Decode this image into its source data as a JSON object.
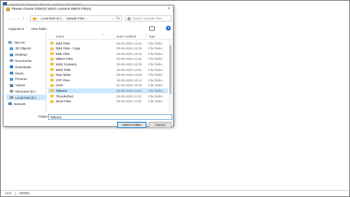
{
  "app": {
    "title": "4n6 Email Forensics Wizard - A Product by 4n6 Inc.",
    "version": "v4.5",
    "mode": "DEMO"
  },
  "dialog": {
    "title": "Please choose folder(s) which contains MBOX File(s).",
    "close_glyph": "×",
    "nav": {
      "back": "←",
      "forward": "→",
      "recent": "⌄",
      "up": "↑"
    },
    "address": {
      "segments": [
        "Local Disk (E:)",
        "Sample Files"
      ],
      "arrow": "›",
      "dropdown": "⌄",
      "refresh": "↻"
    },
    "search": {
      "placeholder": "Search Sample Files"
    },
    "toolbar": {
      "organize": "Organize ▾",
      "new_folder": "New folder",
      "help": "?"
    },
    "tree": [
      {
        "label": "This PC",
        "icon": "computer-icon",
        "color": "#6aa7d8"
      },
      {
        "label": "3D Objects",
        "icon": "cube-icon",
        "color": "#5aa0e0"
      },
      {
        "label": "Desktop",
        "icon": "desktop-icon",
        "color": "#3c8fd8"
      },
      {
        "label": "Documents",
        "icon": "document-icon",
        "color": "#8aa0b8"
      },
      {
        "label": "Downloads",
        "icon": "download-icon",
        "color": "#2f7fd0"
      },
      {
        "label": "Music",
        "icon": "music-icon",
        "color": "#3d8bd6"
      },
      {
        "label": "Pictures",
        "icon": "picture-icon",
        "color": "#4c9ad8"
      },
      {
        "label": "Videos",
        "icon": "video-icon",
        "color": "#4c7bb8"
      },
      {
        "label": "Memories (D:)",
        "icon": "drive-icon",
        "color": "#9a9a9a"
      },
      {
        "label": "Local Disk (E:)",
        "icon": "drive-icon",
        "color": "#9a9a9a",
        "selected": true
      },
      {
        "label": "Network",
        "icon": "network-icon",
        "color": "#4a86c8"
      }
    ],
    "columns": {
      "name": "Name",
      "date": "Date modified",
      "type": "Type",
      "sort_glyph": "^"
    },
    "files": [
      {
        "name": "DBX Files",
        "date": "28-04-2020 13:22",
        "type": "File folder"
      },
      {
        "name": "DBX Files - Copy",
        "date": "28-04-2020 15:09",
        "type": "File folder"
      },
      {
        "name": "EML Files",
        "date": "20-06-2020 18:42",
        "type": "File folder"
      },
      {
        "name": "MBOX Files",
        "date": "02-06-2020 11:45",
        "type": "File folder"
      },
      {
        "name": "MSG Contacts",
        "date": "30-06-2020 16:25",
        "type": "File folder"
      },
      {
        "name": "MSG Files",
        "date": "25-06-2020 11:54",
        "type": "File folder"
      },
      {
        "name": "New folder",
        "date": "08-06-2020 12:50",
        "type": "File folder"
      },
      {
        "name": "OFT Files",
        "date": "15-06-2020 18:12",
        "type": "File folder"
      },
      {
        "name": "OLM",
        "date": "01-05-2020 16:23",
        "type": "File folder"
      },
      {
        "name": "Takeout",
        "date": "02-06-2020 12:01",
        "type": "File folder",
        "selected": true
      },
      {
        "name": "Thunderbird",
        "date": "23-06-2020 11:22",
        "type": "File folder"
      },
      {
        "name": "WLM Files",
        "date": "06-06-2020 11:02",
        "type": "File folder"
      }
    ],
    "folder_label": "Folder:",
    "folder_value": "Takeout",
    "select_button": "Select Folder",
    "cancel_button": "Cancel"
  },
  "colors": {
    "selection": "#cce8ff",
    "folder": "#f2c14e",
    "accent": "#0078d7"
  }
}
